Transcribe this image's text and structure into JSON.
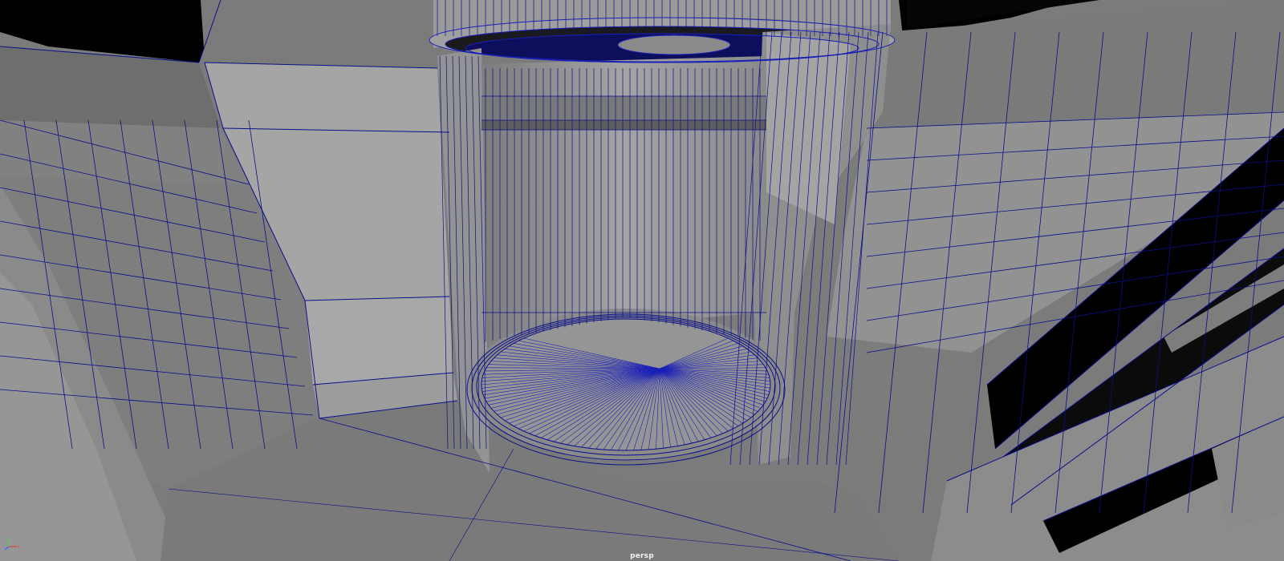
{
  "viewport": {
    "camera_label": "persp",
    "mode": "shaded-with-wireframe",
    "colors": {
      "wire": "#0a0f8a",
      "wire_dense": "#1a1fb8",
      "surface_light": "#a6a6a6",
      "surface_mid": "#8e8e8e",
      "surface_dark": "#707070",
      "void": "#000000"
    }
  },
  "gizmo": {
    "axes": [
      "x",
      "y",
      "z"
    ],
    "axis_colors": {
      "x": "#e04040",
      "y": "#50d050",
      "z": "#4060ff"
    }
  }
}
